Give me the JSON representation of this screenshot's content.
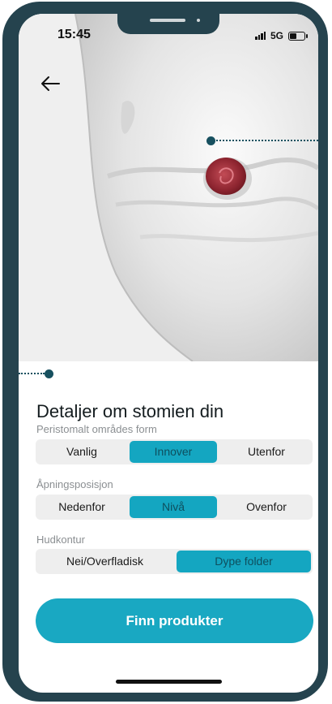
{
  "status_bar": {
    "time": "15:45",
    "network": "5G"
  },
  "illustration": {
    "description_icon": "stoma-body-illustration"
  },
  "details": {
    "title": "Detaljer om stomien din",
    "groups": [
      {
        "label": "Peristomalt områdes form",
        "options": [
          "Vanlig",
          "Innover",
          "Utenfor"
        ],
        "selected": "Innover"
      },
      {
        "label": "Åpningsposisjon",
        "options": [
          "Nedenfor",
          "Nivå",
          "Ovenfor"
        ],
        "selected": "Nivå"
      },
      {
        "label": "Hudkontur",
        "options": [
          "Nei/Overfladisk",
          "Dype folder"
        ],
        "selected": "Dype folder"
      }
    ]
  },
  "cta": {
    "label": "Finn produkter"
  },
  "colors": {
    "accent": "#14a6c1",
    "frame": "#25434e",
    "pointer": "#17505f"
  }
}
